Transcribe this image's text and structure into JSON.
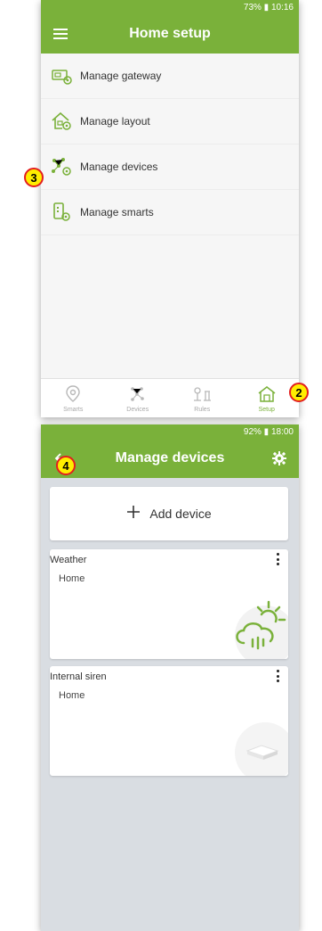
{
  "colors": {
    "accent": "#7ab13a",
    "marker_fill": "#ffee00",
    "marker_border": "#e31e1e"
  },
  "screen1": {
    "status": "73% ▮ 10:16",
    "title": "Home setup",
    "menu_icon": "hamburger-icon",
    "items": [
      {
        "label": "Manage gateway",
        "icon": "gateway-icon"
      },
      {
        "label": "Manage layout",
        "icon": "house-gear-icon"
      },
      {
        "label": "Manage devices",
        "icon": "devices-network-icon"
      },
      {
        "label": "Manage smarts",
        "icon": "smarts-phone-icon"
      }
    ],
    "nav": [
      {
        "label": "Smarts",
        "icon": "location-pin-icon"
      },
      {
        "label": "Devices",
        "icon": "devices-network-icon"
      },
      {
        "label": "Rules",
        "icon": "rules-icon"
      },
      {
        "label": "Setup",
        "icon": "home-setup-icon",
        "active": true
      }
    ]
  },
  "screen2": {
    "status": "92% ▮ 18:00",
    "title": "Manage devices",
    "add_label": "Add device",
    "devices": [
      {
        "name": "Weather",
        "location": "Home",
        "icon": "weather-cloud-sun-icon"
      },
      {
        "name": "Internal siren",
        "location": "Home",
        "icon": "siren-device-icon"
      }
    ]
  },
  "markers": [
    "3",
    "2",
    "4"
  ]
}
